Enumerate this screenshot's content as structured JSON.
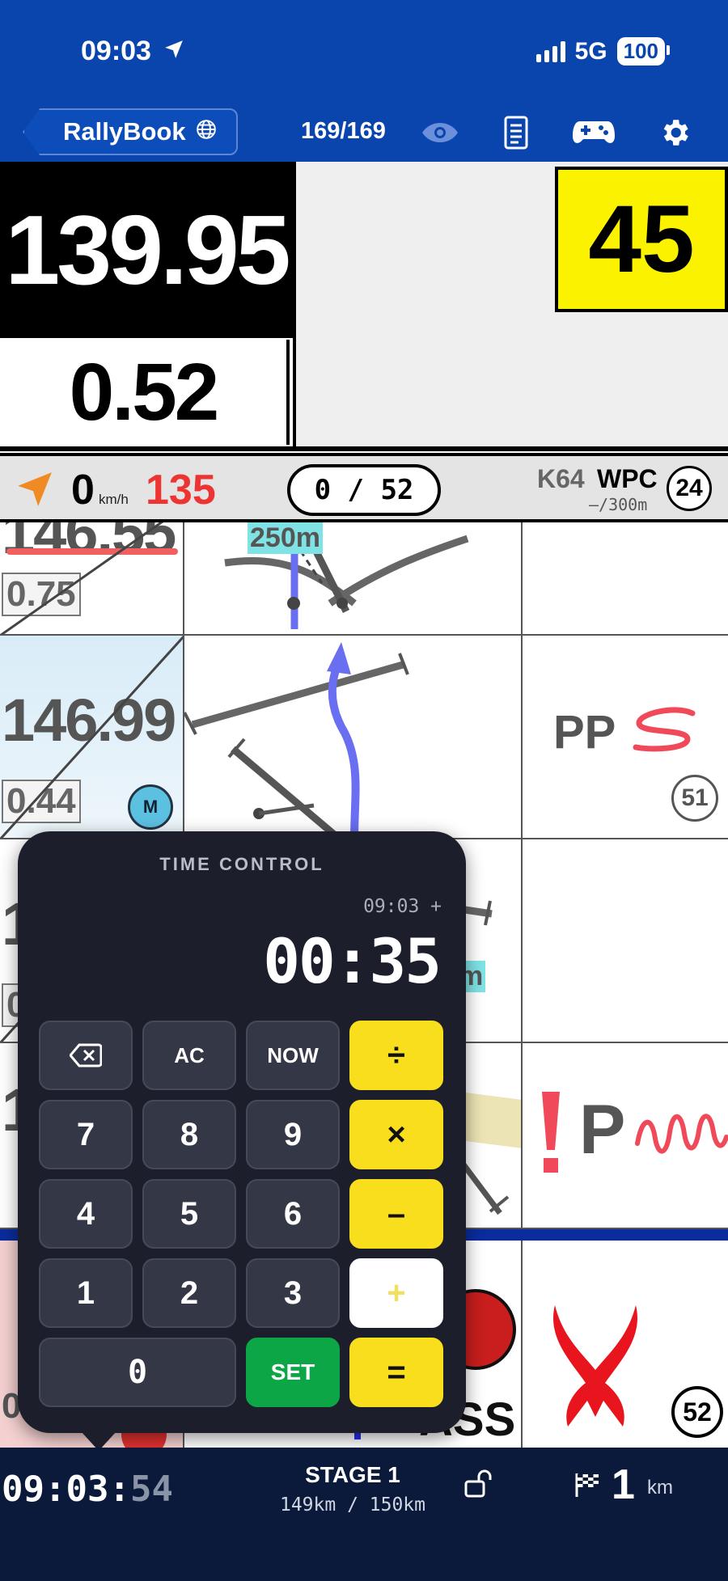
{
  "status_bar": {
    "time": "09:03",
    "network": "5G",
    "battery": "100"
  },
  "nav": {
    "app_button": "RallyBook",
    "counter": "169/169",
    "icons": [
      "eye-icon",
      "document-icon",
      "gamepad-icon",
      "gear-icon"
    ]
  },
  "dashboard": {
    "odometer": "139.95",
    "partial": "0.52",
    "speed_limit": "45",
    "speed": "0",
    "speed_unit": "km/h",
    "max_speed": "135",
    "waypoint_progress": "0 / 52",
    "waypoint_code": "K64",
    "waypoint_type": "WPC",
    "waypoint_distance": "–/300m",
    "waypoint_number": "24"
  },
  "roadbook": {
    "rows": [
      {
        "distance": "146.55",
        "partial": "0.75",
        "tulip_label": "250m"
      },
      {
        "distance": "146.99",
        "partial": "0.44",
        "badge": "M",
        "note": "PP",
        "number": "51"
      },
      {
        "distance": "1",
        "partial": "0",
        "tulip_label": "m"
      },
      {
        "distance": "1",
        "note": "P"
      },
      {
        "distance": "0.",
        "note": "ASS",
        "number": "52"
      }
    ]
  },
  "time_control": {
    "title": "TIME CONTROL",
    "reference": "09:03 +",
    "display": "00:35",
    "keys": {
      "backspace": "⌫",
      "ac": "AC",
      "now": "NOW",
      "divide": "÷",
      "seven": "7",
      "eight": "8",
      "nine": "9",
      "multiply": "×",
      "four": "4",
      "five": "5",
      "six": "6",
      "minus": "–",
      "one": "1",
      "two": "2",
      "three": "3",
      "plus": "+",
      "zero": "0",
      "set": "SET",
      "equals": "="
    }
  },
  "bottom_bar": {
    "clock_hm": "09:03:",
    "clock_s": "54",
    "stage": "STAGE 1",
    "stage_progress": "149km / 150km",
    "distance_value": "1",
    "distance_unit": "km"
  },
  "colors": {
    "header_blue": "#0a44ad",
    "speed_limit_yellow": "#fbf200",
    "operator_yellow": "#f8de1c",
    "set_green": "#0ca647",
    "max_speed_red": "#e33333",
    "route_blue": "#6a6ef0"
  }
}
